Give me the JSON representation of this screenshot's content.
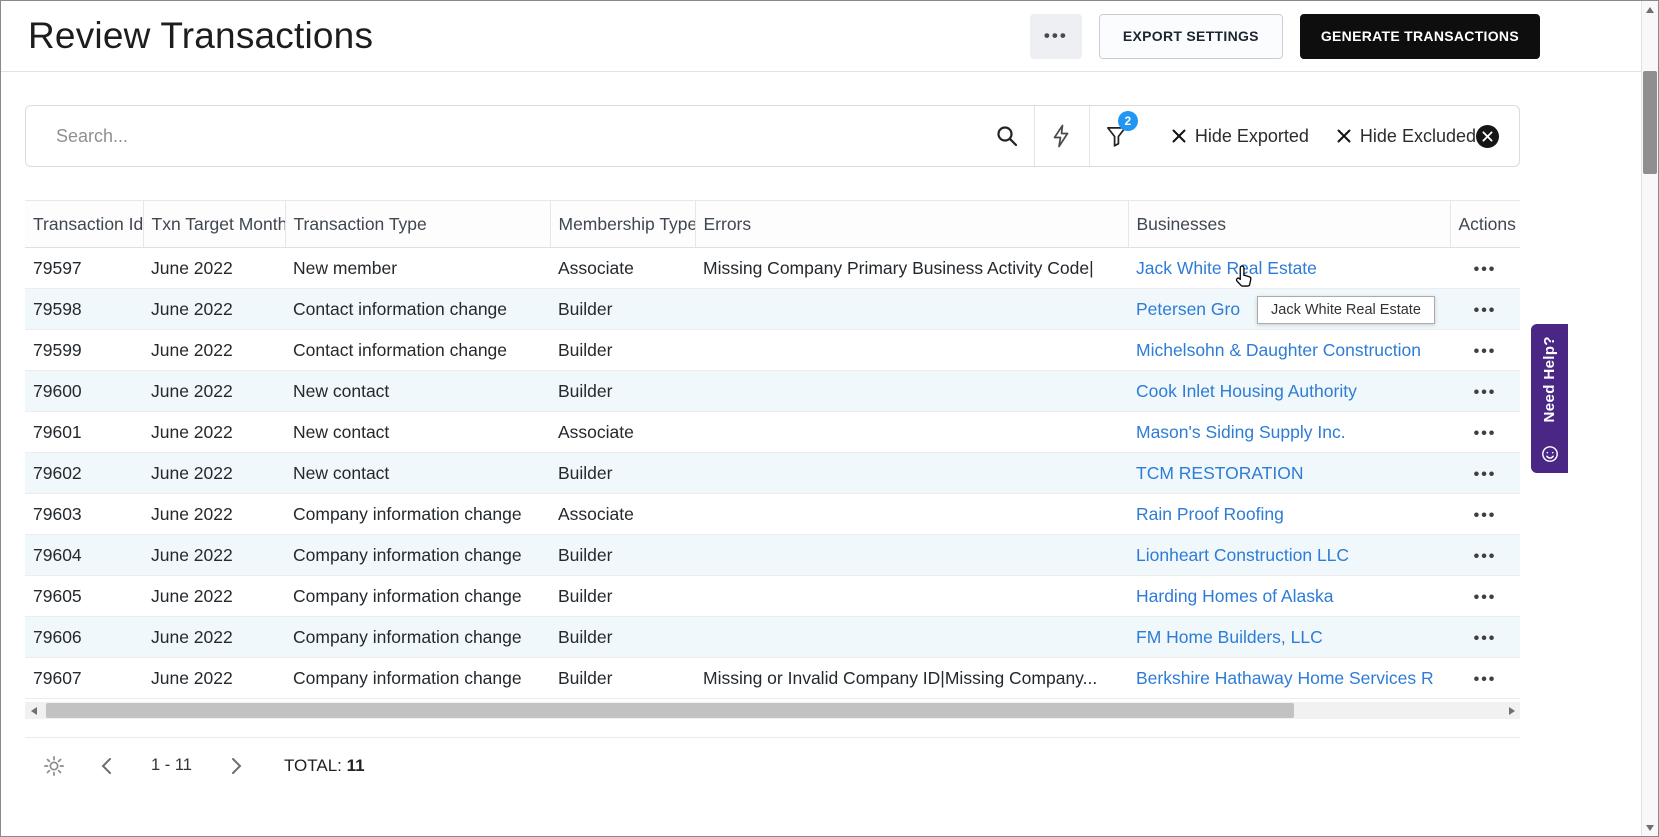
{
  "header": {
    "title": "Review Transactions",
    "more_label": "•••",
    "export_label": "EXPORT SETTINGS",
    "generate_label": "GENERATE TRANSACTIONS"
  },
  "search": {
    "placeholder": "Search...",
    "filter_count": "2",
    "chips": [
      {
        "label": "Hide Exported"
      },
      {
        "label": "Hide Excluded"
      }
    ]
  },
  "table": {
    "columns": [
      "Transaction Id",
      "Txn Target Month",
      "Transaction Type",
      "Membership Type",
      "Errors",
      "Businesses",
      "Actions"
    ],
    "actions_dots": "•••",
    "rows": [
      {
        "id": "79597",
        "target_month": "June 2022",
        "type": "New member",
        "membership": "Associate",
        "errors": "Missing Company Primary Business Activity Code|",
        "business": "Jack White Real Estate"
      },
      {
        "id": "79598",
        "target_month": "June 2022",
        "type": "Contact information change",
        "membership": "Builder",
        "errors": "",
        "business": "Petersen Gro"
      },
      {
        "id": "79599",
        "target_month": "June 2022",
        "type": "Contact information change",
        "membership": "Builder",
        "errors": "",
        "business": "Michelsohn & Daughter Construction"
      },
      {
        "id": "79600",
        "target_month": "June 2022",
        "type": "New contact",
        "membership": "Builder",
        "errors": "",
        "business": "Cook Inlet Housing Authority"
      },
      {
        "id": "79601",
        "target_month": "June 2022",
        "type": "New contact",
        "membership": "Associate",
        "errors": "",
        "business": "Mason's Siding Supply Inc."
      },
      {
        "id": "79602",
        "target_month": "June 2022",
        "type": "New contact",
        "membership": "Builder",
        "errors": "",
        "business": "TCM RESTORATION"
      },
      {
        "id": "79603",
        "target_month": "June 2022",
        "type": "Company information change",
        "membership": "Associate",
        "errors": "",
        "business": "Rain Proof Roofing"
      },
      {
        "id": "79604",
        "target_month": "June 2022",
        "type": "Company information change",
        "membership": "Builder",
        "errors": "",
        "business": "Lionheart Construction LLC"
      },
      {
        "id": "79605",
        "target_month": "June 2022",
        "type": "Company information change",
        "membership": "Builder",
        "errors": "",
        "business": "Harding Homes of Alaska"
      },
      {
        "id": "79606",
        "target_month": "June 2022",
        "type": "Company information change",
        "membership": "Builder",
        "errors": "",
        "business": "FM Home Builders, LLC"
      },
      {
        "id": "79607",
        "target_month": "June 2022",
        "type": "Company information change",
        "membership": "Builder",
        "errors": "Missing or Invalid Company ID|Missing Company...",
        "business": "Berkshire Hathaway Home Services R"
      }
    ]
  },
  "tooltip": {
    "text": "Jack White Real Estate"
  },
  "footer": {
    "range": "1 - 11",
    "total_label": "TOTAL:",
    "total_value": "11"
  },
  "help_tab": {
    "label": "Need Help?"
  },
  "colors": {
    "link": "#2e7cd6",
    "filter_badge": "#2196f3",
    "help_purple": "#4a2784",
    "generate_button_bg": "#0e0e0e",
    "row_alt": "#f0f8fc"
  }
}
